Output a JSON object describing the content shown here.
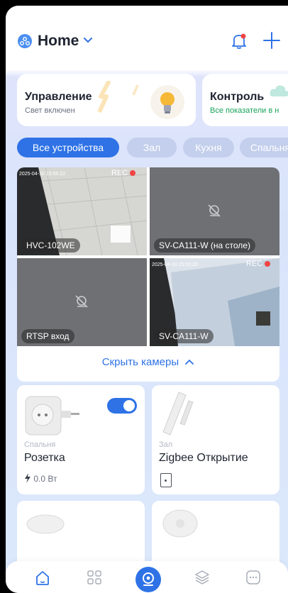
{
  "header": {
    "title": "Home"
  },
  "cards": [
    {
      "title": "Управление",
      "subtitle": "Свет включен"
    },
    {
      "title": "Контроль",
      "subtitle": "Все показатели в н"
    }
  ],
  "chips": [
    {
      "label": "Все устройства",
      "active": true
    },
    {
      "label": "Зал",
      "active": false
    },
    {
      "label": "Кухня",
      "active": false
    },
    {
      "label": "Спальня",
      "active": false
    }
  ],
  "cameras": [
    {
      "label": "HVC-102WE",
      "timestamp": "2025-04-10 15:55:22",
      "rec": "REC",
      "online": true
    },
    {
      "label": "SV-CA111-W (на столе)",
      "online": false
    },
    {
      "label": "RTSP вход",
      "online": false
    },
    {
      "label": "SV-CA111-W",
      "timestamp": "2025-04-10 15:55:20",
      "rec": "REC",
      "online": true
    }
  ],
  "hide_cameras": "Скрыть камеры",
  "devices": [
    {
      "room": "Спальня",
      "name": "Розетка",
      "power": "0.0 Вт",
      "toggle_on": true
    },
    {
      "room": "Зал",
      "name": "Zigbee Открытие"
    }
  ],
  "colors": {
    "accent": "#2e72e6",
    "rec": "#f04444"
  },
  "tabbar": [
    "home-icon",
    "devices-icon",
    "camera-icon",
    "layers-icon",
    "more-icon"
  ]
}
